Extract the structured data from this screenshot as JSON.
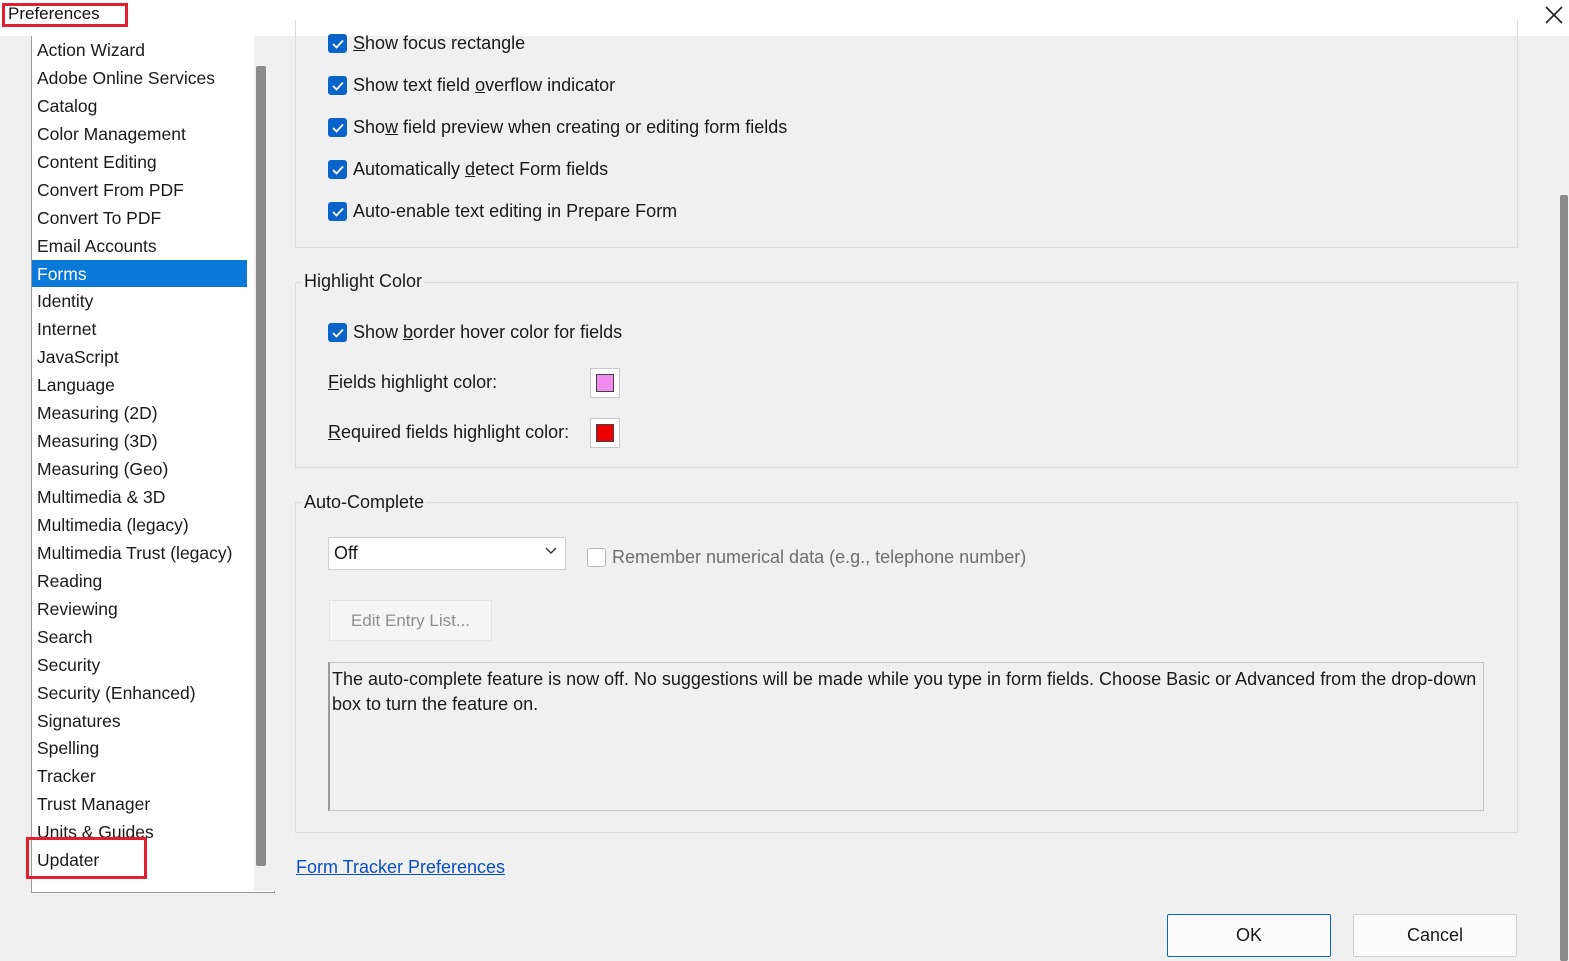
{
  "window": {
    "title": "Preferences"
  },
  "sidebar": {
    "items": [
      {
        "label": "Action Wizard",
        "selected": false
      },
      {
        "label": "Adobe Online Services",
        "selected": false
      },
      {
        "label": "Catalog",
        "selected": false
      },
      {
        "label": "Color Management",
        "selected": false
      },
      {
        "label": "Content Editing",
        "selected": false
      },
      {
        "label": "Convert From PDF",
        "selected": false
      },
      {
        "label": "Convert To PDF",
        "selected": false
      },
      {
        "label": "Email Accounts",
        "selected": false
      },
      {
        "label": "Forms",
        "selected": true
      },
      {
        "label": "Identity",
        "selected": false
      },
      {
        "label": "Internet",
        "selected": false
      },
      {
        "label": "JavaScript",
        "selected": false
      },
      {
        "label": "Language",
        "selected": false
      },
      {
        "label": "Measuring (2D)",
        "selected": false
      },
      {
        "label": "Measuring (3D)",
        "selected": false
      },
      {
        "label": "Measuring (Geo)",
        "selected": false
      },
      {
        "label": "Multimedia & 3D",
        "selected": false
      },
      {
        "label": "Multimedia (legacy)",
        "selected": false
      },
      {
        "label": "Multimedia Trust (legacy)",
        "selected": false
      },
      {
        "label": "Reading",
        "selected": false
      },
      {
        "label": "Reviewing",
        "selected": false
      },
      {
        "label": "Search",
        "selected": false
      },
      {
        "label": "Security",
        "selected": false
      },
      {
        "label": "Security (Enhanced)",
        "selected": false
      },
      {
        "label": "Signatures",
        "selected": false
      },
      {
        "label": "Spelling",
        "selected": false
      },
      {
        "label": "Tracker",
        "selected": false
      },
      {
        "label": "Trust Manager",
        "selected": false
      },
      {
        "label": "Units & Guides",
        "selected": false
      },
      {
        "label": "Updater",
        "selected": false
      }
    ]
  },
  "general": {
    "focus_rect": {
      "pre": "",
      "u": "S",
      "post": "how focus rectangle",
      "checked": true
    },
    "overflow": {
      "pre": "Show text field ",
      "u": "o",
      "post": "verflow indicator",
      "checked": true
    },
    "preview": {
      "pre": "Sho",
      "u": "w",
      "post": " field preview when creating or editing form fields",
      "checked": true
    },
    "auto_detect": {
      "pre": "Automatically ",
      "u": "d",
      "post": "etect Form fields",
      "checked": true
    },
    "auto_enable": {
      "label": "Auto-enable text editing in Prepare Form",
      "checked": true
    }
  },
  "highlight": {
    "group_label": "Highlight Color",
    "border_hover": {
      "pre": "Show ",
      "u": "b",
      "post": "order hover color for fields",
      "checked": true
    },
    "fields_color": {
      "u": "F",
      "post": "ields highlight color:",
      "color": "#f08cf0"
    },
    "required_color": {
      "u": "R",
      "post": "equired fields highlight color:",
      "color": "#ee0000"
    }
  },
  "autocomplete": {
    "group_label": "Auto-Complete",
    "mode": "Off",
    "remember_numeric": {
      "label": "Remember numerical data (e.g., telephone number)",
      "checked": false
    },
    "edit_button": "Edit Entry List...",
    "description": "The auto-complete feature is now off. No suggestions will be made while you type in form fields. Choose Basic or Advanced from the drop-down box to turn the feature on."
  },
  "links": {
    "tracker": "Form Tracker Preferences"
  },
  "buttons": {
    "ok": "OK",
    "cancel": "Cancel"
  },
  "icons": {
    "close": "close-icon",
    "check": "check-icon",
    "dropdown": "chevron-down-icon"
  },
  "colors": {
    "accent": "#0a78d7",
    "checkbox": "#0a63c9",
    "highlight_annotation": "#e0202e"
  }
}
